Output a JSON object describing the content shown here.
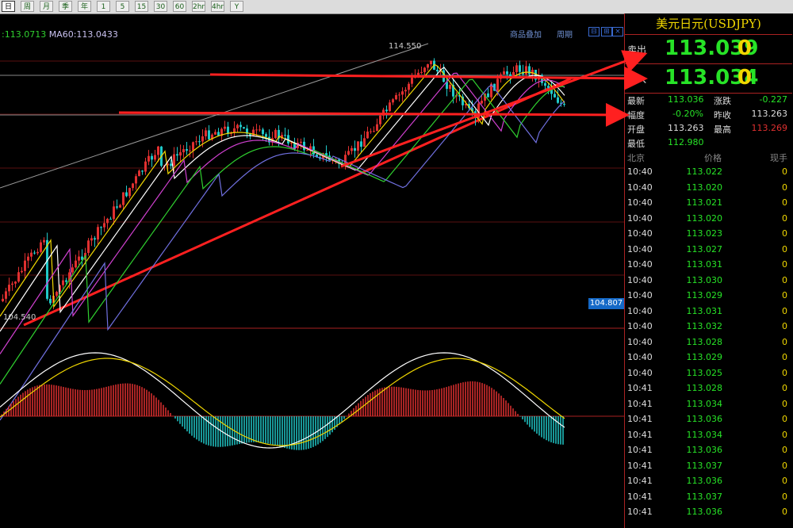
{
  "toolbar": {
    "buttons": [
      "日",
      "周",
      "月",
      "季",
      "年",
      "1",
      "5",
      "15",
      "30",
      "60",
      "2hr",
      "4hr",
      "Y"
    ]
  },
  "chart": {
    "ma_label_left": ":113.0713",
    "ma_label_ma60": "MA60:113.0433",
    "link_overlay": "商品叠加",
    "link_period": "周期",
    "high_label": "114.550",
    "low_label": "104.540",
    "price_tag": "104.807"
  },
  "panel": {
    "title": "美元日元(USDJPY)",
    "sell_label": "卖出",
    "sell_price": "113.039",
    "sell_vol": "0",
    "buy_label": "买入",
    "buy_price": "113.034",
    "buy_vol": "0",
    "stats": {
      "latest_label": "最新",
      "latest": "113.036",
      "change_label": "涨跌",
      "change": "-0.227",
      "amp_label": "幅度",
      "amp": "-0.20%",
      "prev_label": "昨收",
      "prev": "113.263",
      "open_label": "开盘",
      "open": "113.263",
      "high_label": "最高",
      "high": "113.269",
      "low_label": "最低",
      "low": "112.980"
    },
    "ticks_header": {
      "loc": "北京",
      "price": "价格",
      "vol": "现手"
    },
    "ticks": [
      {
        "time": "10:40",
        "price": "113.022",
        "vol": "0"
      },
      {
        "time": "10:40",
        "price": "113.020",
        "vol": "0"
      },
      {
        "time": "10:40",
        "price": "113.021",
        "vol": "0"
      },
      {
        "time": "10:40",
        "price": "113.020",
        "vol": "0"
      },
      {
        "time": "10:40",
        "price": "113.023",
        "vol": "0"
      },
      {
        "time": "10:40",
        "price": "113.027",
        "vol": "0"
      },
      {
        "time": "10:40",
        "price": "113.031",
        "vol": "0"
      },
      {
        "time": "10:40",
        "price": "113.030",
        "vol": "0"
      },
      {
        "time": "10:40",
        "price": "113.029",
        "vol": "0"
      },
      {
        "time": "10:40",
        "price": "113.031",
        "vol": "0"
      },
      {
        "time": "10:40",
        "price": "113.032",
        "vol": "0"
      },
      {
        "time": "10:40",
        "price": "113.028",
        "vol": "0"
      },
      {
        "time": "10:40",
        "price": "113.029",
        "vol": "0"
      },
      {
        "time": "10:40",
        "price": "113.025",
        "vol": "0"
      },
      {
        "time": "10:41",
        "price": "113.028",
        "vol": "0"
      },
      {
        "time": "10:41",
        "price": "113.034",
        "vol": "0"
      },
      {
        "time": "10:41",
        "price": "113.036",
        "vol": "0"
      },
      {
        "time": "10:41",
        "price": "113.034",
        "vol": "0"
      },
      {
        "time": "10:41",
        "price": "113.036",
        "vol": "0"
      },
      {
        "time": "10:41",
        "price": "113.037",
        "vol": "0"
      },
      {
        "time": "10:41",
        "price": "113.036",
        "vol": "0"
      },
      {
        "time": "10:41",
        "price": "113.037",
        "vol": "0"
      },
      {
        "time": "10:41",
        "price": "113.036",
        "vol": "0"
      }
    ]
  },
  "colors": {
    "up": "#e03030",
    "down": "#20c8c8",
    "accent_yellow": "#f0d700",
    "green": "#27e327"
  }
}
